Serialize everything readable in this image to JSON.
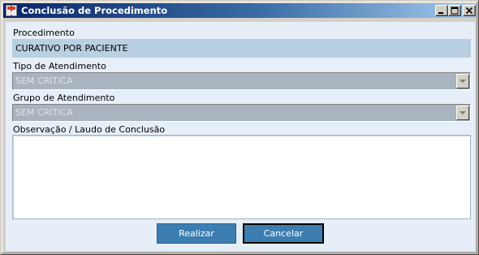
{
  "window": {
    "title": "Conclusão de Procedimento"
  },
  "form": {
    "procedimento_label": "Procedimento",
    "procedimento_value": "CURATIVO POR PACIENTE",
    "tipo_label": "Tipo de Atendimento",
    "tipo_value": "SEM CRITICA",
    "grupo_label": "Grupo de Atendimento",
    "grupo_value": "SEM CRITICA",
    "observacao_label": "Observação / Laudo de Conclusão",
    "observacao_value": ""
  },
  "actions": {
    "realizar_label": "Realizar",
    "cancelar_label": "Cancelar"
  },
  "colors": {
    "titlebar_start": "#0a246a",
    "titlebar_end": "#a6caf0",
    "panel_bg": "#e6eef7",
    "readonly_field_bg": "#b9cfe2",
    "button_bg": "#3c7db2"
  },
  "icons": {
    "app": "app-icon",
    "minimize": "minimize-icon",
    "maximize": "maximize-icon",
    "close": "close-icon",
    "dropdown": "chevron-down-icon"
  }
}
